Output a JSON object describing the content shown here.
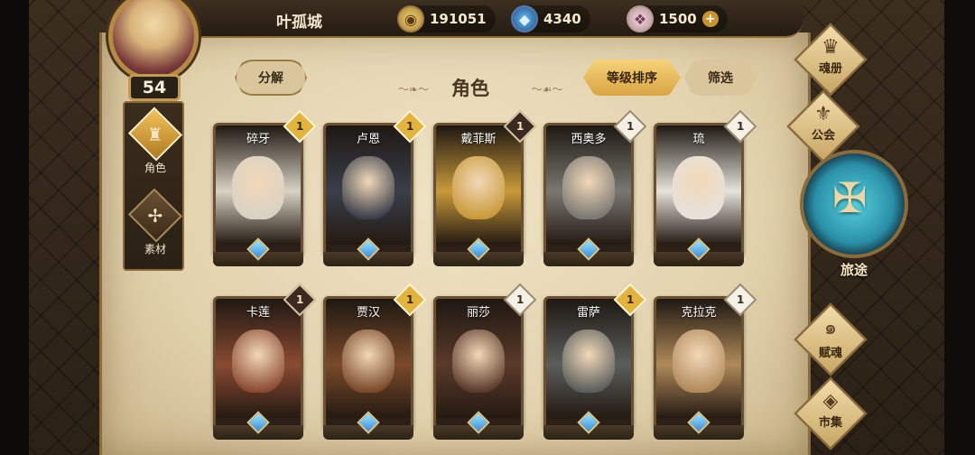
{
  "player": {
    "name": "叶孤城",
    "level": "54"
  },
  "currencies": [
    {
      "icon": "gold-coin-icon",
      "value": "191051"
    },
    {
      "icon": "blue-crystal-icon",
      "value": "4340"
    },
    {
      "icon": "pink-gem-icon",
      "value": "1500"
    }
  ],
  "left_nav": {
    "items": [
      {
        "label": "角色",
        "icon": "character-helmet-icon",
        "active": true
      },
      {
        "label": "素材",
        "icon": "material-wings-icon",
        "active": false
      }
    ]
  },
  "toolbar": {
    "decompose_label": "分解",
    "sort_label": "等级排序",
    "filter_label": "筛选",
    "section_title": "角色"
  },
  "cards": [
    {
      "name": "碎牙",
      "level": "1",
      "badge": "gold",
      "theme": "#d8d2c4"
    },
    {
      "name": "卢恩",
      "level": "1",
      "badge": "gold",
      "theme": "#3a3f4a"
    },
    {
      "name": "戴菲斯",
      "level": "1",
      "badge": "dark",
      "theme": "#c99a3a"
    },
    {
      "name": "西奥多",
      "level": "1",
      "badge": "white",
      "theme": "#7a7872"
    },
    {
      "name": "琉",
      "level": "1",
      "badge": "white",
      "theme": "#e6e2dc"
    },
    {
      "name": "卡莲",
      "level": "1",
      "badge": "dark",
      "theme": "#8a4a32"
    },
    {
      "name": "贾汉",
      "level": "1",
      "badge": "gold",
      "theme": "#7a4a2a"
    },
    {
      "name": "丽莎",
      "level": "1",
      "badge": "white",
      "theme": "#5a3a2a"
    },
    {
      "name": "雷萨",
      "level": "1",
      "badge": "gold",
      "theme": "#5a5e5c"
    },
    {
      "name": "克拉克",
      "level": "1",
      "badge": "white",
      "theme": "#b08a5a"
    }
  ],
  "right_menu": {
    "items": [
      {
        "label": "魂册",
        "icon": "soul-book-icon"
      },
      {
        "label": "公会",
        "icon": "guild-emblem-icon"
      },
      {
        "label": "赋魂",
        "icon": "soul-swirl-icon"
      },
      {
        "label": "市集",
        "icon": "market-crystal-icon"
      }
    ],
    "journey_label": "旅途"
  },
  "colors": {
    "accent_gold": "#e3b340",
    "parchment": "#e2d2ad",
    "frame_brown": "#8a6b3e",
    "journey_teal": "#2a8fa8"
  }
}
